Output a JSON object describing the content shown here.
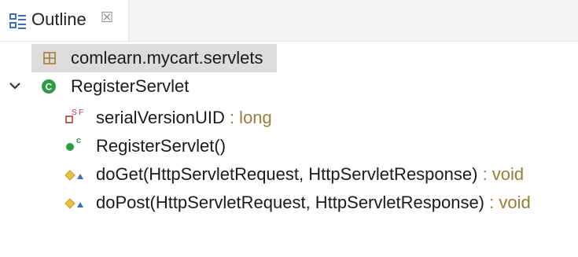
{
  "view": {
    "tab_label": "Outline",
    "tab_icon": "outline-view-icon",
    "close_icon": "close-icon"
  },
  "tree": {
    "package": {
      "label": "comlearn.mycart.servlets",
      "icon": "package-icon",
      "selected": true
    },
    "class": {
      "label": "RegisterServlet",
      "icon": "class-icon",
      "expanded": true,
      "members": [
        {
          "name": "serialVersionUID",
          "type": " : long",
          "icon": "private-static-final-field-icon",
          "badge": "SF"
        },
        {
          "name": "RegisterServlet()",
          "type": "",
          "icon": "public-constructor-icon",
          "badge": "C"
        },
        {
          "name": "doGet(HttpServletRequest, HttpServletResponse)",
          "type": " : void",
          "icon": "protected-overridden-method-icon",
          "badge": ""
        },
        {
          "name": "doPost(HttpServletRequest, HttpServletResponse)",
          "type": " : void",
          "icon": "protected-overridden-method-icon",
          "badge": ""
        }
      ]
    }
  },
  "colors": {
    "class_green": "#2e9c45",
    "type_text": "#967d3c",
    "selected_row": "#dcdcdc",
    "field_red": "#c33b3b",
    "method_yellow": "#e7c24a",
    "override_blue": "#3f6fb0"
  }
}
